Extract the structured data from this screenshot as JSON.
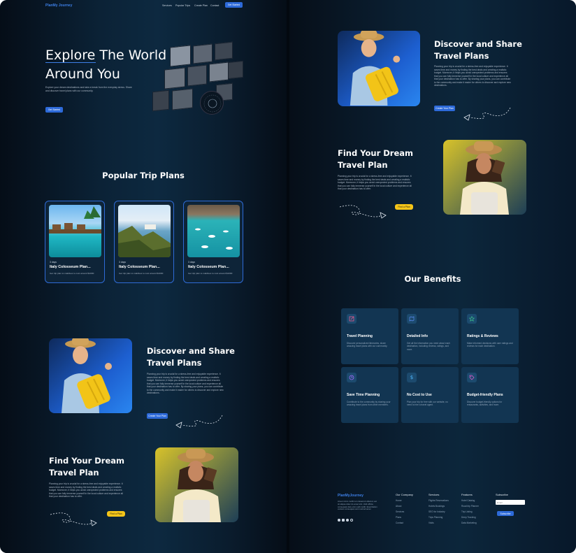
{
  "nav": {
    "brand": "PlanMy Journey",
    "links": [
      "Services",
      "Popular Trips",
      "Create Plan",
      "Contact"
    ],
    "cta": "Get Started"
  },
  "hero": {
    "title_line1": "Explore The World",
    "title_line2": "Around You",
    "subtitle": "Explore your dream destinations and take a break from the everyday stress. Share and discover travel plans with our community.",
    "button": "Get Started",
    "badge_text": "EXPLORE · TRAVEL · EXPLORE · CREATE"
  },
  "popular": {
    "heading": "Popular Trip Plans",
    "cards": [
      {
        "days": "3 days",
        "title": "Italy Colosseum Plan...",
        "desc": "Get trip plan to maldives to cost around $1000",
        "image": "maldives-overwater-villas"
      },
      {
        "days": "3 days",
        "title": "Italy Colosseum Plan...",
        "desc": "Get trip plan to maldives to cost around $1000",
        "image": "coastal-cliff-house"
      },
      {
        "days": "3 days",
        "title": "Italy Colosseum Plan...",
        "desc": "Get trip plan to maldives to cost around $1000",
        "image": "turquoise-bay-boats"
      }
    ]
  },
  "share": {
    "heading_line1": "Discover and Share",
    "heading_line2": "Travel Plans",
    "text": "Planning your trip is crucial for a stress-free and enjoyable experience. It saves time and money by finding the best deals and creating a realistic budget. Moreover, it helps you avoid unexpected problems and ensures that you can fully immerse yourself in the local culture and experience all that your destination has to offer. By sharing your plans, you can contribute to the community and make it easier for others to discover and explore new destinations.",
    "button": "Create Your Plan"
  },
  "dream": {
    "heading_line1": "Find Your Dream",
    "heading_line2": "Travel Plan",
    "text": "Planning your trip is crucial for a stress-free and enjoyable experience. It saves time and money by finding the best deals and creating a realistic budget. Moreover, it helps you avoid unexpected problems and ensures that you can fully immerse yourself in the local culture and experience all that your destination has to offer.",
    "button": "Find a Plan"
  },
  "benefits": {
    "heading": "Our Benefits",
    "items": [
      {
        "title": "Travel Planning",
        "desc": "Discover personalized itineraries, share amazing travel plans with our community.",
        "icon": "edit-icon"
      },
      {
        "title": "Detailed Info",
        "desc": "Get all the information you need about each destination, including reviews, ratings, and more.",
        "icon": "map-icon"
      },
      {
        "title": "Ratings & Reviews",
        "desc": "Make informed decisions with user ratings and reviews for each destination.",
        "icon": "star-icon"
      },
      {
        "title": "Save Time Planning",
        "desc": "Contribute to the community by sharing your amazing travel plans from other members.",
        "icon": "clock-icon"
      },
      {
        "title": "No Cost to Use",
        "desc": "Plan your trip for free with our website, no need to hire a travel agent.",
        "icon": "dollar-icon"
      },
      {
        "title": "Budget-friendly Plans",
        "desc": "Discover budget-friendly options for restaurants, activities, and more.",
        "icon": "tag-icon"
      }
    ]
  },
  "footer": {
    "brand": "PlanMyJourney",
    "about": "Amet minim mollit non deserunt ullamco est sit aliqua dolor do amet sint. Velit officia consequat duis enim velit mollit. Exercitation veniam consequat sunt nostrud amet.",
    "columns": [
      {
        "heading": "Our Company",
        "items": [
          "Home",
          "About",
          "Services",
          "Plans",
          "Contact"
        ]
      },
      {
        "heading": "Services",
        "items": [
          "Flights Reservations",
          "Hotels Bookings",
          "SEO for Industry",
          "Trips Planning",
          "Visits"
        ]
      },
      {
        "heading": "Features",
        "items": [
          "Hotel Catalog",
          "Road trip Planner",
          "Trip Listing",
          "Deep Tracking",
          "Data Marketing"
        ]
      }
    ],
    "subscribe_heading": "Subscribe",
    "subscribe_placeholder": "Email",
    "subscribe_button": "Subscribe"
  }
}
